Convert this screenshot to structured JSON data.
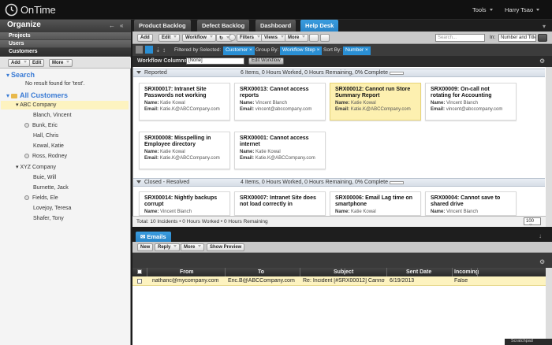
{
  "app": {
    "brand": "OnTime",
    "tools_label": "Tools",
    "user_label": "Harry Tsao"
  },
  "left": {
    "title": "Organize",
    "nav": [
      "Projects",
      "Users",
      "Customers"
    ],
    "toolbar": {
      "add": "Add",
      "edit": "Edit",
      "more": "More"
    },
    "search": {
      "title": "Search",
      "no_result": "No result found for 'test'."
    },
    "customers": {
      "title": "All Customers",
      "groups": [
        {
          "name": "ABC Company",
          "members": [
            "Blanch, Vincent",
            "Bunk, Eric",
            "Hall, Chris",
            "Kowal, Katie",
            "Ross, Rodney"
          ]
        },
        {
          "name": "XYZ Company",
          "members": [
            "Buie, Will",
            "Burnette, Jack",
            "Fields, Ele",
            "Lovejoy, Teresa",
            "Shafer, Tony"
          ]
        }
      ]
    }
  },
  "tabs": [
    "Product Backlog",
    "Defect Backlog",
    "Dashboard",
    "Help Desk"
  ],
  "active_tab": "Help Desk",
  "toolbar": {
    "add": "Add",
    "edit": "Edit",
    "workflow": "Workflow",
    "filters": "Filters",
    "views": "Views",
    "more": "More",
    "search_placeholder": "Search...",
    "in_label": "In:",
    "in_value": "Number and Title"
  },
  "filterbar": {
    "filtered_label": "Filtered by Selected:",
    "filtered_value": "Customer",
    "group_label": "Group By:",
    "group_value": "Workflow Step",
    "sort_label": "Sort By:",
    "sort_value": "Number"
  },
  "workflow_columns": {
    "label": "Workflow Columns:",
    "value": "[None]",
    "button": "Edit Workflow"
  },
  "groups": [
    {
      "name": "Reported",
      "stats": "6 Items, 0 Hours Worked, 0 Hours Remaining, 0% Complete",
      "cards": [
        {
          "title": "SRX00017: Intranet Site Passwords not working",
          "name": "Katie Kowal",
          "email": "Katie.K@ABCCompany.com"
        },
        {
          "title": "SRX00013: Cannot access reports",
          "name": "Vincent Blanch",
          "email": "vincent@abccompany.com"
        },
        {
          "title": "SRX00012: Cannot run Store Summary Report",
          "name": "Katie Kowal",
          "email": "Katie.K@ABCCompany.com"
        },
        {
          "title": "SRX00009: On-call not rotating for Accounting",
          "name": "Vincent Blanch",
          "email": "vincent@abccompany.com"
        },
        {
          "title": "SRX00008: Misspelling in Employee directory",
          "name": "Katie Kowal",
          "email": "Katie.K@ABCCompany.com"
        },
        {
          "title": "SRX00001: Cannot access internet",
          "name": "Katie Kowal",
          "email": "Katie.K@ABCCompany.com"
        }
      ]
    },
    {
      "name": "Closed - Resolved",
      "stats": "4 Items, 0 Hours Worked, 0 Hours Remaining, 0% Complete",
      "cards": [
        {
          "title": "SRX00014: Nightly backups corrupt",
          "name": "Vincent Blanch",
          "email": ""
        },
        {
          "title": "SRX00007: Intranet Site does not load correctly in",
          "name": "",
          "email": ""
        },
        {
          "title": "SRX00006: Email Lag time on smartphone",
          "name": "Katie Kowal",
          "email": ""
        },
        {
          "title": "SRX00004: Cannot save to shared drive",
          "name": "Vincent Blanch",
          "email": ""
        }
      ]
    }
  ],
  "labels": {
    "name": "Name:",
    "email": "Email:"
  },
  "totals": "Total: 10 Incidents • 0 Hours Worked • 0 Hours Remaining",
  "page_size": "100",
  "emails": {
    "tab": "Emails",
    "toolbar": {
      "new": "New",
      "reply": "Reply",
      "more": "More",
      "preview": "Show Preview"
    },
    "columns": [
      "From",
      "To",
      "Subject",
      "Sent Date",
      "Incoming"
    ],
    "rows": [
      {
        "from": "nathanc@mycompany.com",
        "to": "Eric.B@ABCCompany.com",
        "subject": "Re: Incident [#SRX00012] Cannot run",
        "date": "6/19/2013",
        "incoming": "False"
      }
    ]
  },
  "scratchpad": "Scratchpad"
}
